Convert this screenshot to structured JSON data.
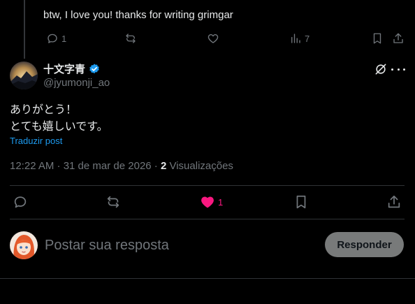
{
  "previous_reply": {
    "text": "btw, I love you! thanks for writing grimgar",
    "reply_count": "1",
    "views_count": "7"
  },
  "post": {
    "author_name": "十文字青",
    "handle": "@jyumonji_ao",
    "lines": [
      "ありがとう！",
      "とても嬉しいです。"
    ],
    "translate_label": "Traduzir post",
    "timestamp": "12:22 AM · 31 de mar de 2026 ·",
    "views_number": "2",
    "views_label": "Visualizações",
    "like_count": "1"
  },
  "reply_box": {
    "placeholder": "Postar sua resposta",
    "button_label": "Responder"
  },
  "colors": {
    "accent": "#1d9bf0",
    "like": "#f91880",
    "muted": "#71767b",
    "divider": "#2f3336"
  }
}
